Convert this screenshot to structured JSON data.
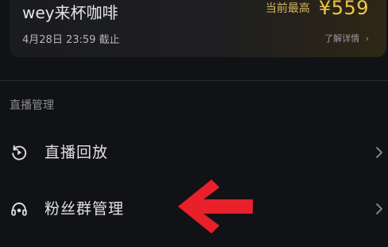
{
  "auction": {
    "title": "wey来杯咖啡",
    "deadline": "4月28日 23:59 截止",
    "price_label": "当前最高",
    "price_value": "¥559",
    "detail_link": "了解详情"
  },
  "section": {
    "title": "直播管理"
  },
  "menu": {
    "items": [
      {
        "label": "直播回放",
        "icon": "replay-icon"
      },
      {
        "label": "粉丝群管理",
        "icon": "fan-group-icon"
      }
    ]
  },
  "annotation": {
    "arrow_color": "#e8202a",
    "icon": "red-arrow-left"
  },
  "colors": {
    "background": "#111216",
    "price": "#f2c64a",
    "text": "#e2e2e6",
    "muted": "#8c8c93"
  }
}
